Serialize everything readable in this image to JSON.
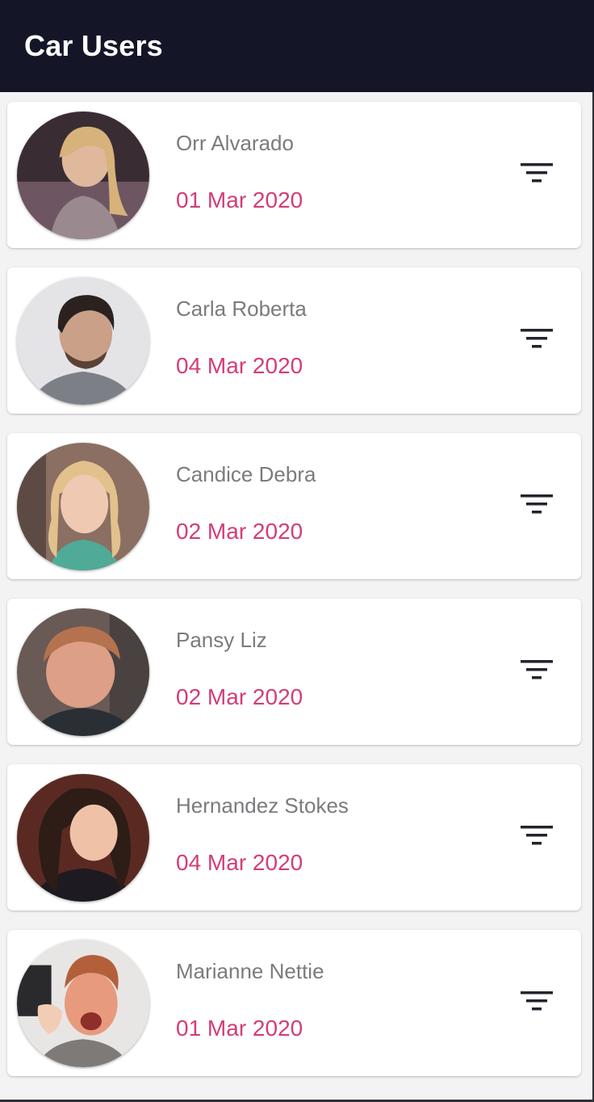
{
  "app_bar": {
    "title": "Car Users"
  },
  "icons": {
    "filter": "filter-list-icon"
  },
  "colors": {
    "app_bar_bg": "#141628",
    "name_text": "#7b7b7f",
    "date_text": "#d33d78",
    "icon": "#23242e"
  },
  "users": [
    {
      "name": "Orr Alvarado",
      "date": "01 Mar 2020"
    },
    {
      "name": "Carla Roberta",
      "date": "04 Mar 2020"
    },
    {
      "name": "Candice Debra",
      "date": "02 Mar 2020"
    },
    {
      "name": "Pansy Liz",
      "date": "02 Mar 2020"
    },
    {
      "name": "Hernandez Stokes",
      "date": "04 Mar 2020"
    },
    {
      "name": "Marianne Nettie",
      "date": "01 Mar 2020"
    }
  ]
}
